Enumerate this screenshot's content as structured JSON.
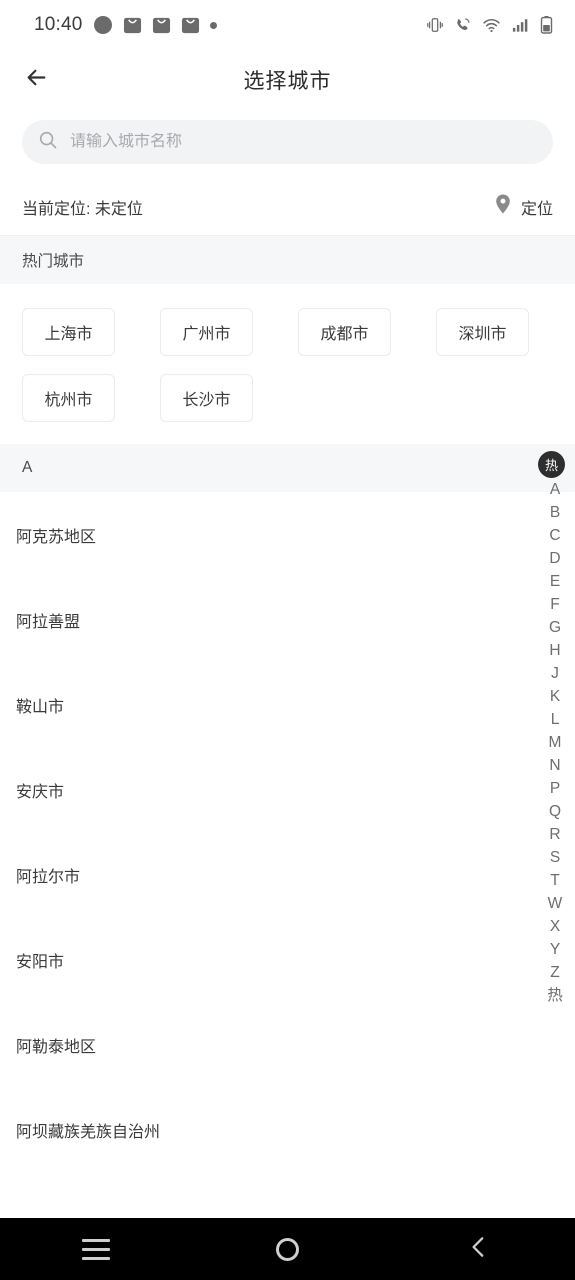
{
  "status_bar": {
    "time": "10:40",
    "left_icons": [
      "compass-icon",
      "mail-icon",
      "mail-icon",
      "mail-icon",
      "dot-icon"
    ],
    "right_icons": [
      "vibrate-icon",
      "wifi-call-icon",
      "wifi-icon",
      "signal-icon",
      "battery-icon"
    ]
  },
  "header": {
    "title": "选择城市",
    "back_icon": "arrow-left-icon"
  },
  "search": {
    "placeholder": "请输入城市名称",
    "value": "",
    "icon": "search-icon"
  },
  "location": {
    "label": "当前定位: 未定位",
    "button_label": "定位",
    "button_icon": "map-pin-icon"
  },
  "hot_section": {
    "title": "热门城市",
    "cities": [
      "上海市",
      "广州市",
      "成都市",
      "深圳市",
      "杭州市",
      "长沙市"
    ]
  },
  "list_section": {
    "letter": "A",
    "cities": [
      "阿克苏地区",
      "阿拉善盟",
      "鞍山市",
      "安庆市",
      "阿拉尔市",
      "安阳市",
      "阿勒泰地区",
      "阿坝藏族羌族自治州"
    ]
  },
  "index_bar": {
    "badge": "热",
    "letters": [
      "A",
      "B",
      "C",
      "D",
      "E",
      "F",
      "G",
      "H",
      "J",
      "K",
      "L",
      "M",
      "N",
      "P",
      "Q",
      "R",
      "S",
      "T",
      "W",
      "X",
      "Y",
      "Z",
      "热"
    ]
  },
  "nav_bar": {
    "recents_icon": "menu-icon",
    "home_icon": "circle-icon",
    "back_icon": "chevron-left-icon"
  },
  "colors": {
    "background": "#ffffff",
    "section_bg": "#f6f7f9",
    "search_bg": "#f2f3f5",
    "text_primary": "#3a3a3a",
    "text_muted": "#a6a9ad",
    "nav_bg": "#000000",
    "badge_bg": "#2e2e2e"
  }
}
